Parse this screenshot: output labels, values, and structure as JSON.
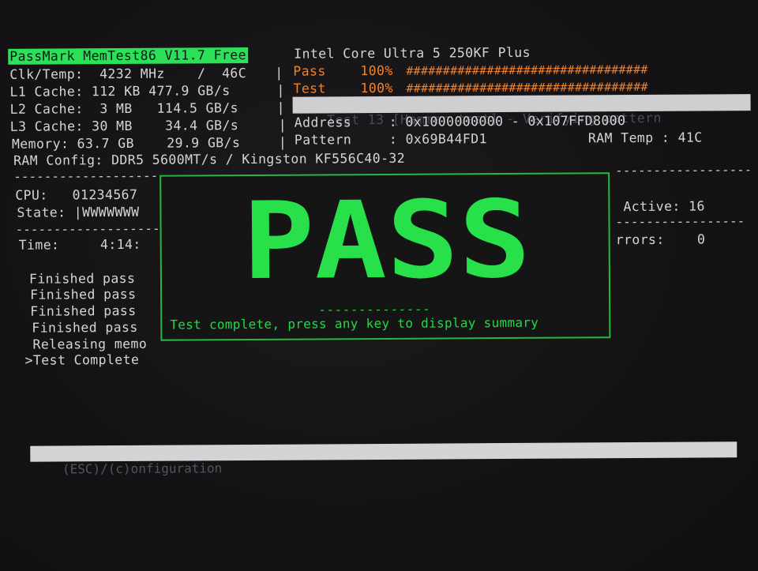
{
  "header": {
    "title": "PassMark MemTest86 V11.7 Free",
    "cpu_name": "Intel Core Ultra 5 250KF Plus"
  },
  "system": {
    "clk_temp": "Clk/Temp:  4232 MHz    /  46C",
    "l1": "L1 Cache: 112 KB 477.9 GB/s",
    "l2": "L2 Cache:  3 MB   114.5 GB/s",
    "l3": "L3 Cache: 30 MB    34.4 GB/s",
    "memory": "Memory: 63.7 GB    29.9 GB/s",
    "ram_config": "RAM Config: DDR5 5600MT/s / Kingston KF556C40-32"
  },
  "progress": {
    "pass_label": "Pass",
    "pass_pct": "100%",
    "pass_bar": "#################################",
    "pass_fraction": 1.0,
    "test_label": "Test",
    "test_pct": "100%",
    "test_bar": "#################################",
    "test_fraction": 1.0,
    "current_test": "Test 13 [Hammer test] - Verifying pattern",
    "address_label": "Address",
    "address_value": ": 0x1000000000 - 0x107FFD8000",
    "pattern_label": "Pattern",
    "pattern_value": ": 0x69B44FD1",
    "ram_temp": "RAM Temp : 41C"
  },
  "cpu_panel": {
    "cpu": "CPU:   01234567",
    "state": "State: |WWWWWWW",
    "time": "Time:     4:14:",
    "active": "Active: 16",
    "errors": "rrors:    0"
  },
  "log": [
    "Finished pass",
    "Finished pass",
    "Finished pass",
    "Finished pass",
    "Releasing memo",
    ">Test Complete"
  ],
  "result": {
    "status": "PASS",
    "dashes": "--------------",
    "message": "Test complete, press any key to display summary"
  },
  "footer": {
    "hint": "(ESC)/(c)onfiguration"
  },
  "colors": {
    "title_bg": "#2de05a",
    "progress_orange": "#f2822a",
    "progress_green": "#6fe05a",
    "pass_green": "#27e04a"
  }
}
